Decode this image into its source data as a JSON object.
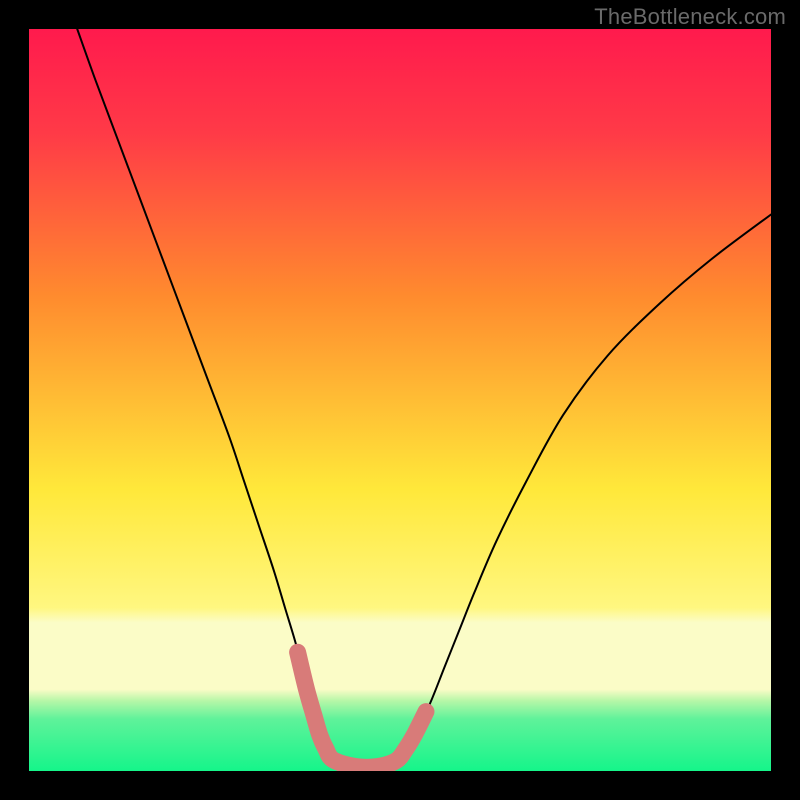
{
  "watermark": "TheBottleneck.com",
  "chart_data": {
    "type": "line",
    "title": "",
    "xlabel": "",
    "ylabel": "",
    "xlim": [
      0,
      100
    ],
    "ylim": [
      0,
      100
    ],
    "gradient_background": {
      "top": "#ff1a4d",
      "mid1": "#ff8b2e",
      "mid2": "#ffe83a",
      "band": "#fbfcc7",
      "bottom": "#15f58a"
    },
    "series": [
      {
        "name": "curve",
        "color": "#000000",
        "stroke_width": 2,
        "x": [
          6.5,
          9,
          12,
          15,
          18,
          21,
          24,
          27,
          29,
          31,
          33,
          34.5,
          36,
          37.2,
          38.2,
          39,
          40,
          41,
          44,
          47,
          49.5,
          50.8,
          52,
          54,
          56,
          58,
          60,
          63,
          67,
          72,
          78,
          85,
          92,
          100
        ],
        "y": [
          100,
          93,
          85,
          77,
          69,
          61,
          53,
          45,
          39,
          33,
          27,
          22,
          17,
          12,
          8,
          5,
          3,
          1.5,
          0.6,
          0.6,
          1.4,
          3,
          5,
          9,
          14,
          19,
          24,
          31,
          39,
          48,
          56,
          63,
          69,
          75
        ]
      },
      {
        "name": "highlight-band",
        "color": "#d87b79",
        "stroke_width": 17,
        "x": [
          36.2,
          37.4,
          38.4,
          39.2,
          40,
          41,
          44,
          47,
          49.5,
          50.8,
          52,
          53.5
        ],
        "y": [
          16,
          11,
          7.5,
          4.8,
          3,
          1.5,
          0.6,
          0.6,
          1.4,
          3,
          5,
          8
        ]
      }
    ]
  }
}
